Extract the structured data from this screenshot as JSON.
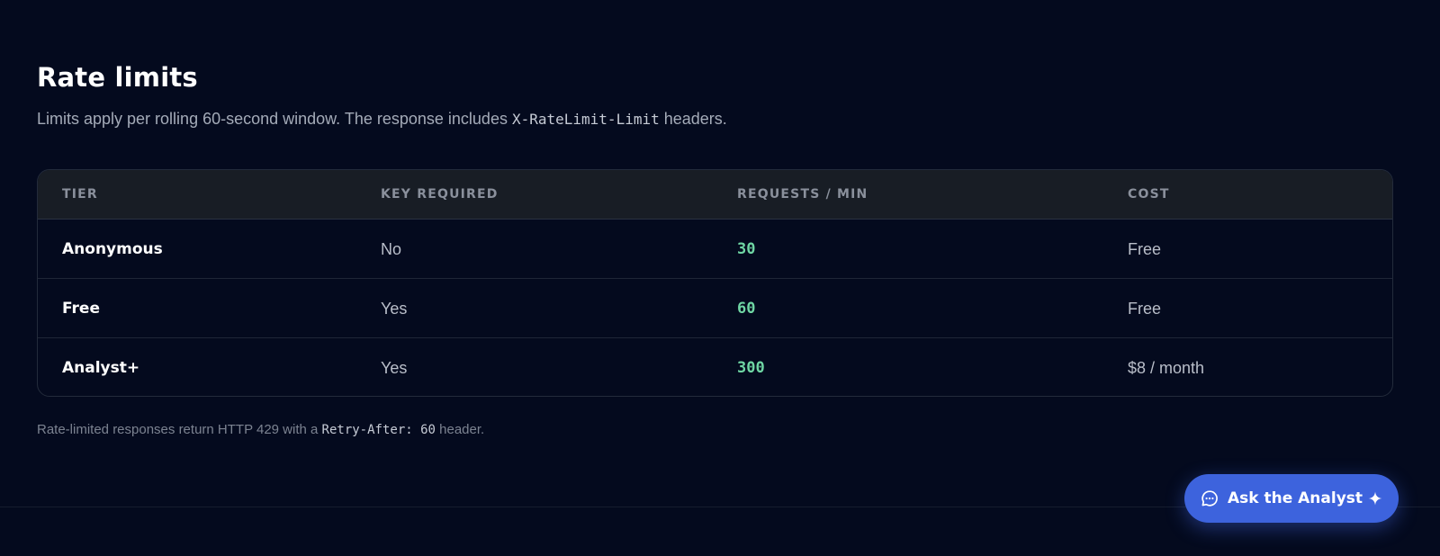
{
  "section": {
    "title": "Rate limits",
    "intro_before": "Limits apply per rolling 60-second window. The response includes ",
    "intro_code": "X-RateLimit-Limit",
    "intro_after": " headers."
  },
  "table": {
    "headers": [
      "TIER",
      "KEY REQUIRED",
      "REQUESTS / MIN",
      "COST"
    ],
    "rows": [
      {
        "tier": "Anonymous",
        "key_required": "No",
        "requests_per_min": "30",
        "cost": "Free"
      },
      {
        "tier": "Free",
        "key_required": "Yes",
        "requests_per_min": "60",
        "cost": "Free"
      },
      {
        "tier": "Analyst+",
        "key_required": "Yes",
        "requests_per_min": "300",
        "cost": "$8 / month"
      }
    ]
  },
  "footnote": {
    "before": "Rate-limited responses return HTTP 429 with a ",
    "code": "Retry-After: 60",
    "after": " header."
  },
  "assistant_button": {
    "label": "Ask the Analyst",
    "icon": "chat-bubble-icon",
    "trailing_icon": "sparkle-icon"
  },
  "colors": {
    "background": "#040a1e",
    "accent_button": "#3d63dd",
    "rpm_green": "#6fd6a4",
    "header_bg": "#181d25"
  }
}
